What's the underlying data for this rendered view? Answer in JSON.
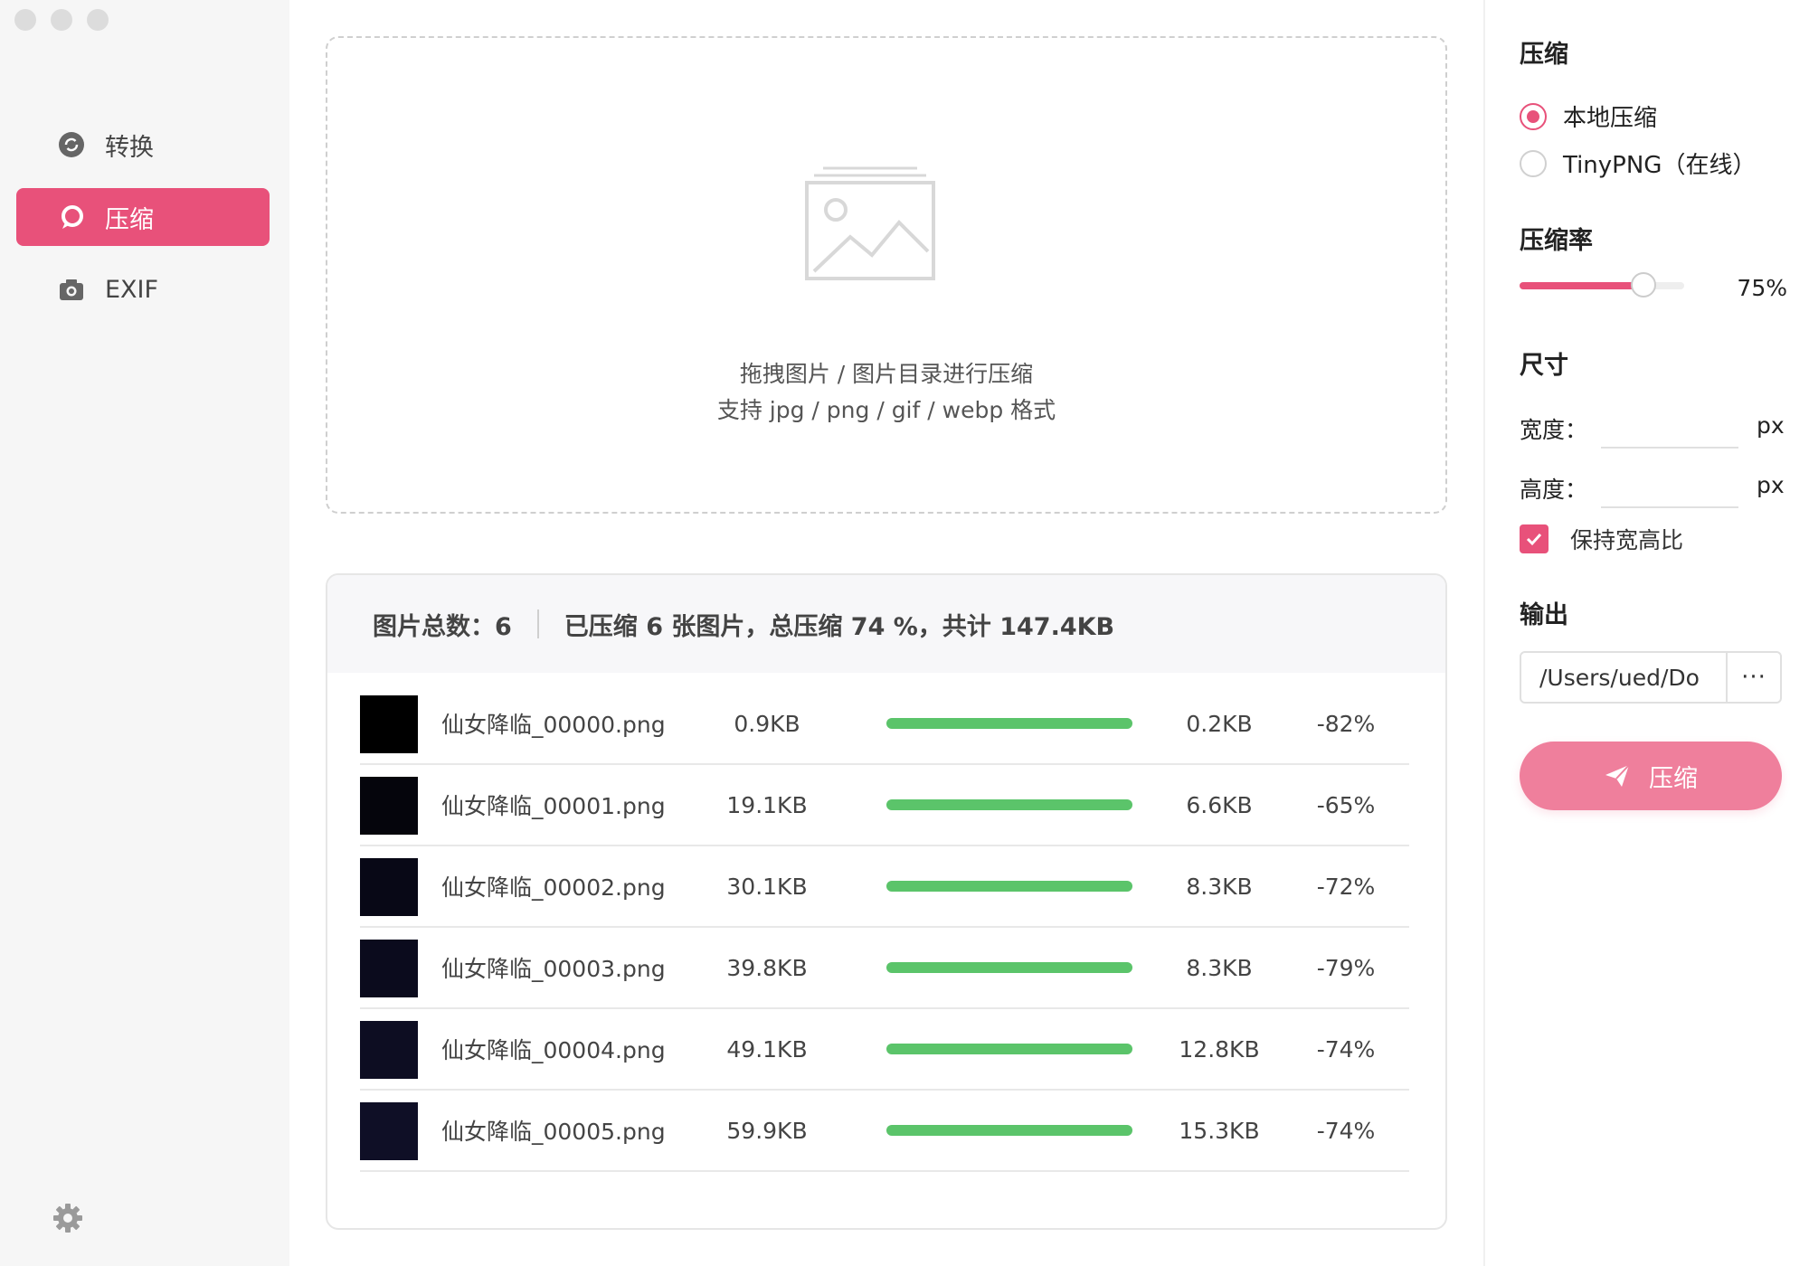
{
  "sidebar": {
    "items": [
      {
        "label": "转换",
        "icon": "convert-icon"
      },
      {
        "label": "压缩",
        "icon": "compress-icon"
      },
      {
        "label": "EXIF",
        "icon": "camera-icon"
      }
    ],
    "settings_icon": "gear-icon"
  },
  "dropzone": {
    "icon": "image-placeholder-icon",
    "line1": "拖拽图片 / 图片目录进行压缩",
    "line2": "支持 jpg / png / gif / webp 格式"
  },
  "summary": {
    "total": "图片总数：6",
    "detail": "已压缩 6 张图片，总压缩 74 %，共计 147.4KB"
  },
  "files": [
    {
      "name": "仙女降临_00000.png",
      "original": "0.9KB",
      "compressed": "0.2KB",
      "ratio": "-82%",
      "progress": 1.0
    },
    {
      "name": "仙女降临_00001.png",
      "original": "19.1KB",
      "compressed": "6.6KB",
      "ratio": "-65%",
      "progress": 1.0
    },
    {
      "name": "仙女降临_00002.png",
      "original": "30.1KB",
      "compressed": "8.3KB",
      "ratio": "-72%",
      "progress": 1.0
    },
    {
      "name": "仙女降临_00003.png",
      "original": "39.8KB",
      "compressed": "8.3KB",
      "ratio": "-79%",
      "progress": 1.0
    },
    {
      "name": "仙女降临_00004.png",
      "original": "49.1KB",
      "compressed": "12.8KB",
      "ratio": "-74%",
      "progress": 1.0
    },
    {
      "name": "仙女降临_00005.png",
      "original": "59.9KB",
      "compressed": "15.3KB",
      "ratio": "-74%",
      "progress": 1.0
    }
  ],
  "panel": {
    "compress_title": "压缩",
    "mode_local": "本地压缩",
    "mode_tinypng": "TinyPNG（在线）",
    "selected_mode": "本地压缩",
    "rate_title": "压缩率",
    "rate_value": "75%",
    "rate_fraction": 0.75,
    "size_title": "尺寸",
    "width_label": "宽度：",
    "height_label": "高度：",
    "width_value": "",
    "height_value": "",
    "unit": "px",
    "keep_ratio_label": "保持宽高比",
    "keep_ratio_checked": true,
    "output_title": "输出",
    "output_path": "/Users/ued/Do",
    "browse_label": "···",
    "compress_button": "压缩"
  },
  "colors": {
    "accent": "#e8517a",
    "button": "#ef7f9c",
    "progress": "#5bc46a"
  }
}
